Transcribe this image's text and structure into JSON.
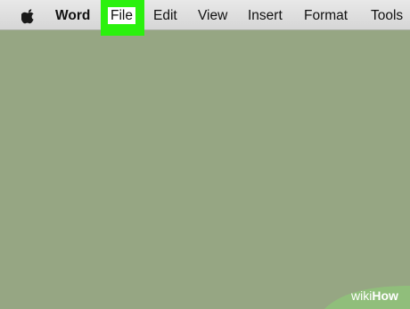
{
  "menubar": {
    "apple_icon": "apple-logo-icon",
    "items": [
      {
        "label": "Word"
      },
      {
        "label": "File"
      },
      {
        "label": "Edit"
      },
      {
        "label": "View"
      },
      {
        "label": "Insert"
      },
      {
        "label": "Format"
      },
      {
        "label": "Tools"
      }
    ]
  },
  "highlight_color": "#2bf10e",
  "watermark": {
    "wiki": "wiki",
    "how": "How"
  }
}
